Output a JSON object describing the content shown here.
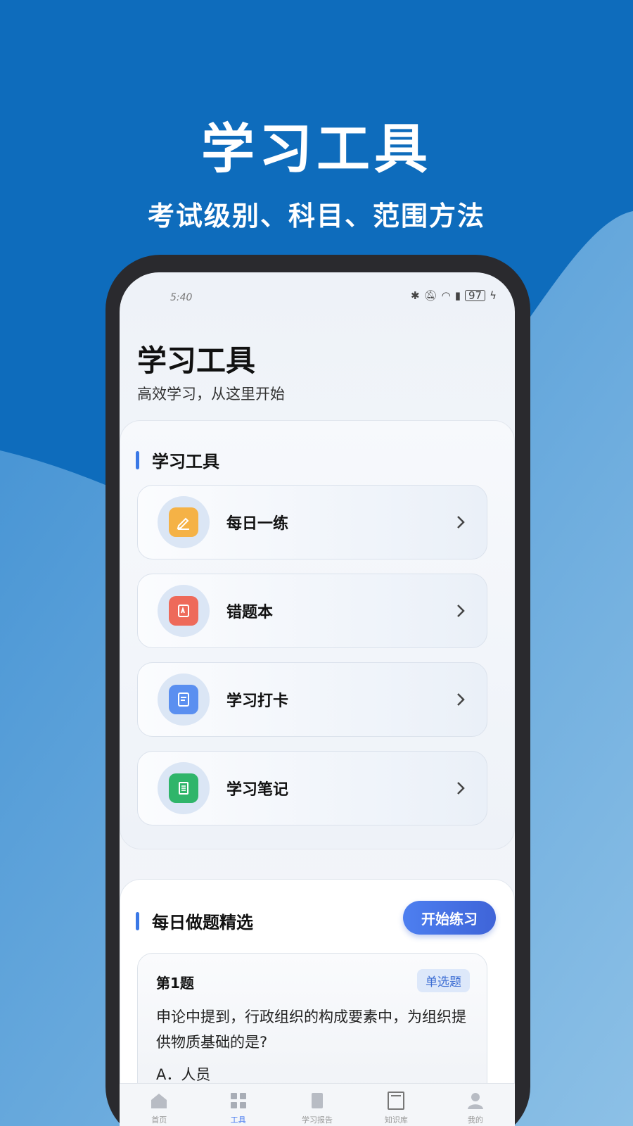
{
  "promo": {
    "title": "学习工具",
    "subtitle": "考试级别、科目、范围方法"
  },
  "status_bar": {
    "time": "5:40",
    "battery": "97"
  },
  "page": {
    "title": "学习工具",
    "subtitle": "高效学习，从这里开始"
  },
  "tools_section": {
    "title": "学习工具",
    "items": [
      {
        "label": "每日一练",
        "icon": "pencil-icon",
        "color": "#f5b246"
      },
      {
        "label": "错题本",
        "icon": "error-book-icon",
        "color": "#ee6a5a"
      },
      {
        "label": "学习打卡",
        "icon": "checkin-icon",
        "color": "#5a8ff0"
      },
      {
        "label": "学习笔记",
        "icon": "notes-icon",
        "color": "#2fb56a"
      }
    ]
  },
  "daily_section": {
    "title": "每日做题精选",
    "start_button": "开始练习",
    "question": {
      "number": "第1题",
      "type": "单选题",
      "text": "申论中提到，行政组织的构成要素中，为组织提供物质基础的是?",
      "option_a": "A．人员"
    }
  },
  "tab_bar": {
    "items": [
      {
        "label": "首页",
        "icon": "home-icon",
        "active": false
      },
      {
        "label": "工具",
        "icon": "tools-icon",
        "active": true
      },
      {
        "label": "学习报告",
        "icon": "report-icon",
        "active": false
      },
      {
        "label": "知识库",
        "icon": "library-icon",
        "active": false
      },
      {
        "label": "我的",
        "icon": "profile-icon",
        "active": false
      }
    ]
  },
  "colors": {
    "background": "#0e6cbc",
    "accent": "#4d7ff0"
  }
}
